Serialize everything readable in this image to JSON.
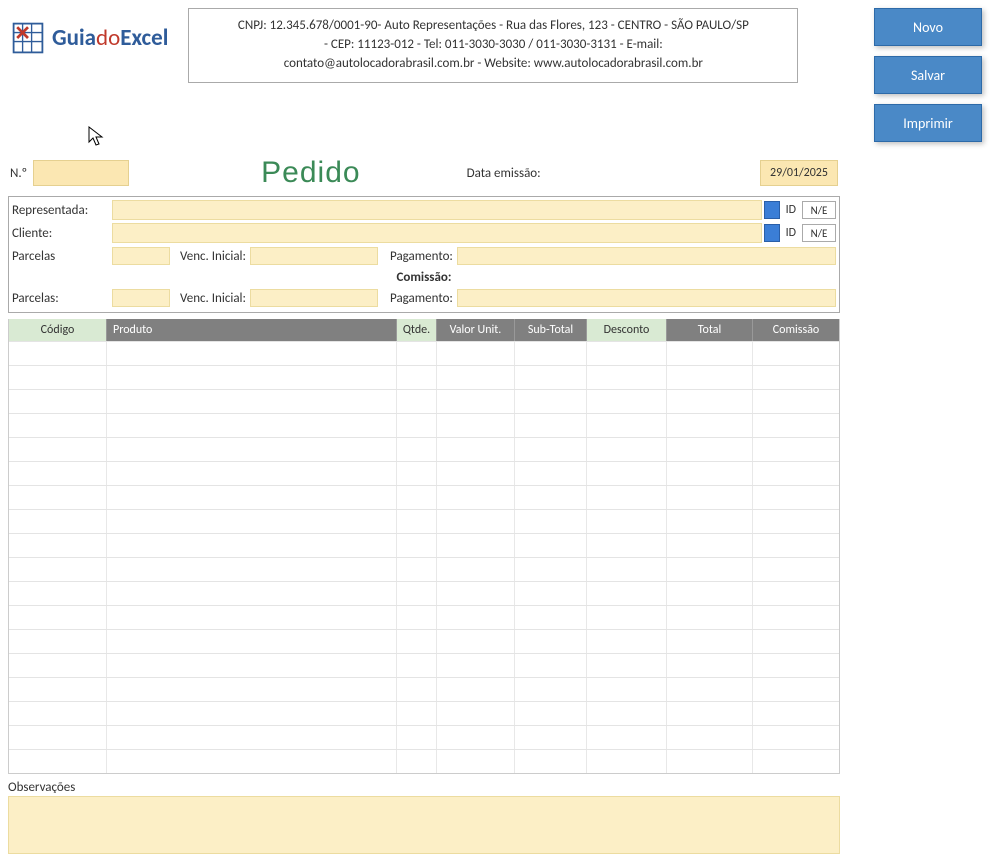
{
  "logo": {
    "guia": "Guia",
    "do": "do",
    "excel": "Excel"
  },
  "company": {
    "line1": "CNPJ: 12.345.678/0001-90- Auto Representações - Rua das Flores, 123 - CENTRO - SÃO PAULO/SP",
    "line2": "- CEP: 11123-012 - Tel: 011-3030-3030 / 011-3030-3131 - E-mail:",
    "line3": "contato@autolocadorabrasil.com.br - Website: www.autolocadorabrasil.com.br"
  },
  "buttons": {
    "novo": "Novo",
    "salvar": "Salvar",
    "imprimir": "Imprimir"
  },
  "title": {
    "no_label": "N.º",
    "pedido": "Pedido",
    "emissao_label": "Data emissão:",
    "date": "29/01/2025"
  },
  "form": {
    "representada": "Representada:",
    "cliente": "Cliente:",
    "parcelas": "Parcelas",
    "parcelas2": "Parcelas:",
    "venc": "Venc. Inicial:",
    "pagamento": "Pagamento:",
    "comissao": "Comissão:",
    "id": "ID",
    "ne": "N/E"
  },
  "table": {
    "headers": {
      "codigo": "Código",
      "produto": "Produto",
      "qtde": "Qtde.",
      "vunit": "Valor Unit.",
      "subtotal": "Sub-Total",
      "desconto": "Desconto",
      "total": "Total",
      "comissao": "Comissão"
    },
    "row_count": 18
  },
  "obs": {
    "label": "Observações"
  }
}
